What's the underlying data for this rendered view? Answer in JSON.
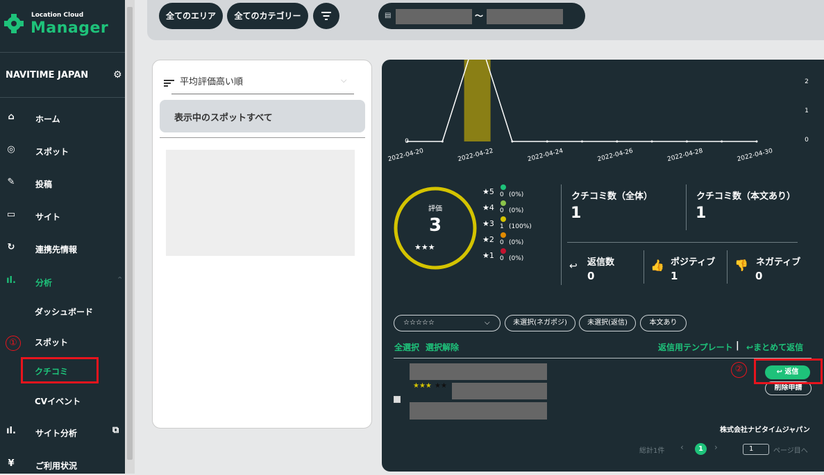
{
  "app": {
    "logo_small": "Location Cloud",
    "logo_main": "Manager"
  },
  "sidebar": {
    "company": "NAVITIME JAPAN",
    "items": [
      {
        "label": "ホーム",
        "icon": "home-icon"
      },
      {
        "label": "スポット",
        "icon": "location-pin-icon"
      },
      {
        "label": "投稿",
        "icon": "edit-icon"
      },
      {
        "label": "サイト",
        "icon": "site-icon"
      },
      {
        "label": "連携先情報",
        "icon": "sync-icon"
      },
      {
        "label": "分析",
        "icon": "bar-chart-icon"
      }
    ],
    "sub_items": [
      "ダッシュボード",
      "スポット",
      "クチコミ",
      "CVイベント"
    ],
    "bottom_items": [
      {
        "label": "サイト分析",
        "icon": "bar-chart-icon"
      },
      {
        "label": "ご利用状況",
        "icon": "yen-icon"
      }
    ],
    "annotation1": "①"
  },
  "filters": {
    "area": "全てのエリア",
    "category": "全てのカテゴリー",
    "date_sep": "〜"
  },
  "list": {
    "sort_label": "平均評価高い順",
    "all_spots": "表示中のスポットすべて"
  },
  "chart_data": {
    "type": "line",
    "x": [
      "2022-04-20",
      "2022-04-21",
      "2022-04-22",
      "2022-04-23",
      "2022-04-24",
      "2022-04-25",
      "2022-04-26",
      "2022-04-27",
      "2022-04-28",
      "2022-04-29",
      "2022-04-30"
    ],
    "tick_labels": [
      "2022-04-20",
      "2022-04-22",
      "2022-04-24",
      "2022-04-26",
      "2022-04-28",
      "2022-04-30"
    ],
    "y_right_ticks": [
      "2",
      "1",
      "0"
    ],
    "y_left_tick": "0",
    "bar_date": "2022-04-22",
    "bar_color": "#8a7f15"
  },
  "rating": {
    "title": "評価",
    "value": "3",
    "stars": "★★★",
    "breakdown": [
      {
        "star": "★5",
        "count": "0",
        "pct": "(0%)",
        "color": "#1ec27a"
      },
      {
        "star": "★4",
        "count": "0",
        "pct": "(0%)",
        "color": "#8bc34a"
      },
      {
        "star": "★3",
        "count": "1",
        "pct": "(100%)",
        "color": "#d4c300"
      },
      {
        "star": "★2",
        "count": "0",
        "pct": "(0%)",
        "color": "#e08a00"
      },
      {
        "star": "★1",
        "count": "0",
        "pct": "(0%)",
        "color": "#c4122f"
      }
    ]
  },
  "stats": {
    "total_label": "クチコミ数（全体）",
    "total_value": "1",
    "body_label": "クチコミ数（本文あり）",
    "body_value": "1",
    "reply_label": "返信数",
    "reply_value": "0",
    "positive_label": "ポジティブ",
    "positive_value": "1",
    "negative_label": "ネガティブ",
    "negative_value": "0"
  },
  "review_filters": {
    "stars": "☆☆☆☆☆",
    "negapos": "未選択(ネガポジ)",
    "reply": "未選択(返信)",
    "body": "本文あり"
  },
  "actions": {
    "select_all": "全選択",
    "deselect": "選択解除",
    "template": "返信用テンプレート",
    "sep": "|",
    "bulk_reply": "まとめて返信"
  },
  "review": {
    "stars": "★★★",
    "reply_btn": "返信",
    "delete_btn": "削除申請",
    "company": "株式会社ナビタイムジャパン",
    "annotation2": "②"
  },
  "pager": {
    "total": "総計1件",
    "page": "1",
    "input_page": "1",
    "page_suffix": "ページ目へ"
  }
}
